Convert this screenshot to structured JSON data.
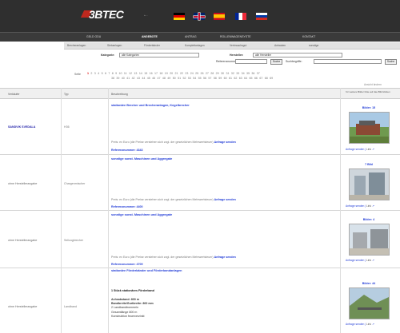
{
  "header": {
    "logo_text": "3BTEC",
    "logo_sub": "",
    "mini_text": "» ...",
    "flags": [
      "de",
      "gb",
      "es",
      "fr",
      "ru"
    ]
  },
  "nav": {
    "items": [
      "GELD ODU",
      "ANGEBOTE",
      "ANTRAG",
      "ROLLENWAGENSYSTE",
      "KONTAKT"
    ]
  },
  "subnav": {
    "items": [
      "Brecheranlagen",
      "Siebanlagen",
      "Förderbänder",
      "Komplettanlagen",
      "Verbrauchsgut",
      "Anbauten",
      "sonstige"
    ]
  },
  "filters": {
    "category_label": "Kategorie:",
    "category_value": "alle Kategorien",
    "maker_label": "Hersteller:",
    "maker_value": "alle Hersteller",
    "refnum_label": "Referenznummer:",
    "search_button": "Suche",
    "keyword_label": "Suchbegriffe:",
    "go_button": "Suche"
  },
  "pagination": {
    "label": "Seite",
    "row1": [
      "1",
      "2",
      "3",
      "4",
      "5",
      "6",
      "7",
      "8",
      "9",
      "10",
      "11",
      "12",
      "13",
      "14",
      "15",
      "16",
      "17",
      "18",
      "19",
      "20",
      "21",
      "22",
      "23",
      "24",
      "25",
      "26",
      "27",
      "28",
      "29",
      "30",
      "31",
      "32",
      "33",
      "34",
      "35",
      "36",
      "37"
    ],
    "row2": [
      "38",
      "39",
      "40",
      "41",
      "42",
      "43",
      "44",
      "45",
      "46",
      "47",
      "48",
      "49",
      "50",
      "51",
      "52",
      "53",
      "54",
      "55",
      "56",
      "57",
      "58",
      "59",
      "60",
      "61",
      "62",
      "63",
      "64",
      "65",
      "66",
      "67",
      "68",
      "69"
    ],
    "detail_link": "Ansicht ändern"
  },
  "table": {
    "headers": {
      "seller": "Verkäufer",
      "type": "Typ",
      "description": "Beschreibung",
      "images": "für weitere Bilder bitte auf das Bild klicken"
    },
    "rows": [
      {
        "seller": "SANDVIK SVEDALA",
        "type": "H36",
        "title": "stationäre Brecher und Brecheranlagen, Kegelbrecher",
        "body": [],
        "price": "Preis: ex Euro (die Preise verstehen sich zzgl. der gesetzlichen Mehrwertsteuer)",
        "price_link": "Anfrage senden",
        "ref": "Referenznummer: 4343",
        "images": "Bilder: 15",
        "actions": "Anfrage senden",
        "link": "Link"
      },
      {
        "seller": "ohne Herstellerangabe",
        "type": "Chargenmischer",
        "title": "sonstige sonst. Maschinen und Aggregate",
        "body": [],
        "price": "Preis: ex Euro (die Preise verstehen sich zzgl. der gesetzlichen Mehrwertsteuer)",
        "price_link": "Anfrage senden",
        "ref": "Referenznummer: 4400",
        "images": "7 Bild",
        "actions": "Anfrage senden",
        "link": "Link"
      },
      {
        "seller": "ohne Herstellerangabe",
        "type": "Seilzugbrecher",
        "title": "sonstige sonst. Maschinen und Aggregate",
        "body": [],
        "price": "Preis: ex Euro (die Preise verstehen sich zzgl. der gesetzlichen Mehrwertsteuer)",
        "price_link": "Anfrage senden",
        "ref": "Referenznummer: 4709",
        "images": "Bilder: 4",
        "actions": "Anfrage senden",
        "link": "Link"
      },
      {
        "seller": "ohne Herstellerangabe",
        "type": "Landband",
        "title": "stationäre Förderbänder und Förderbandanlagen",
        "body_heading": "1 Stück stationäres Förderband",
        "body": [
          "Achsabstand: 800 m",
          "Bandbreite/Gurtbreite: 800 mm",
          "2 Landbandtrommeln",
          "Gesamtlänge 800 m",
          "Konstruktion feuerverzinkt"
        ],
        "price": "",
        "price_link": "",
        "ref": "",
        "images": "Bilder: 44",
        "actions": "Anfrage senden",
        "link": "Link"
      }
    ]
  }
}
